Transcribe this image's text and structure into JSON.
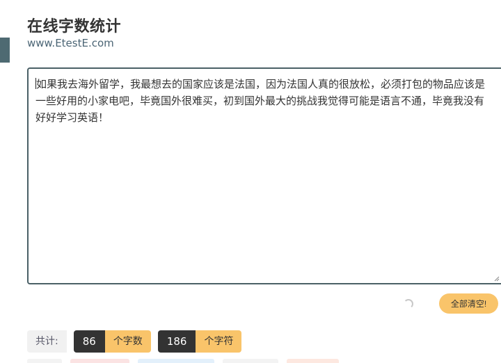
{
  "header": {
    "title": "在线字数统计",
    "url": "www.EtestE.com"
  },
  "editor": {
    "text": "如果我去海外留学，我最想去的国家应该是法国，因为法国人真的很放松，必须打包的物品应该是一些好用的小家电吧，毕竟国外很难买，初到国外最大的挑战我觉得可能是语言不通，毕竟我没有好好学习英语！"
  },
  "actions": {
    "clear_label": "全部清空!"
  },
  "stats": {
    "label": "共计:",
    "word_count": "86",
    "word_unit": "个字数",
    "char_count": "186",
    "char_unit": "个字符"
  },
  "colors": {
    "accent": "#f9c46a",
    "dark": "#333333",
    "border": "#4a6066"
  }
}
